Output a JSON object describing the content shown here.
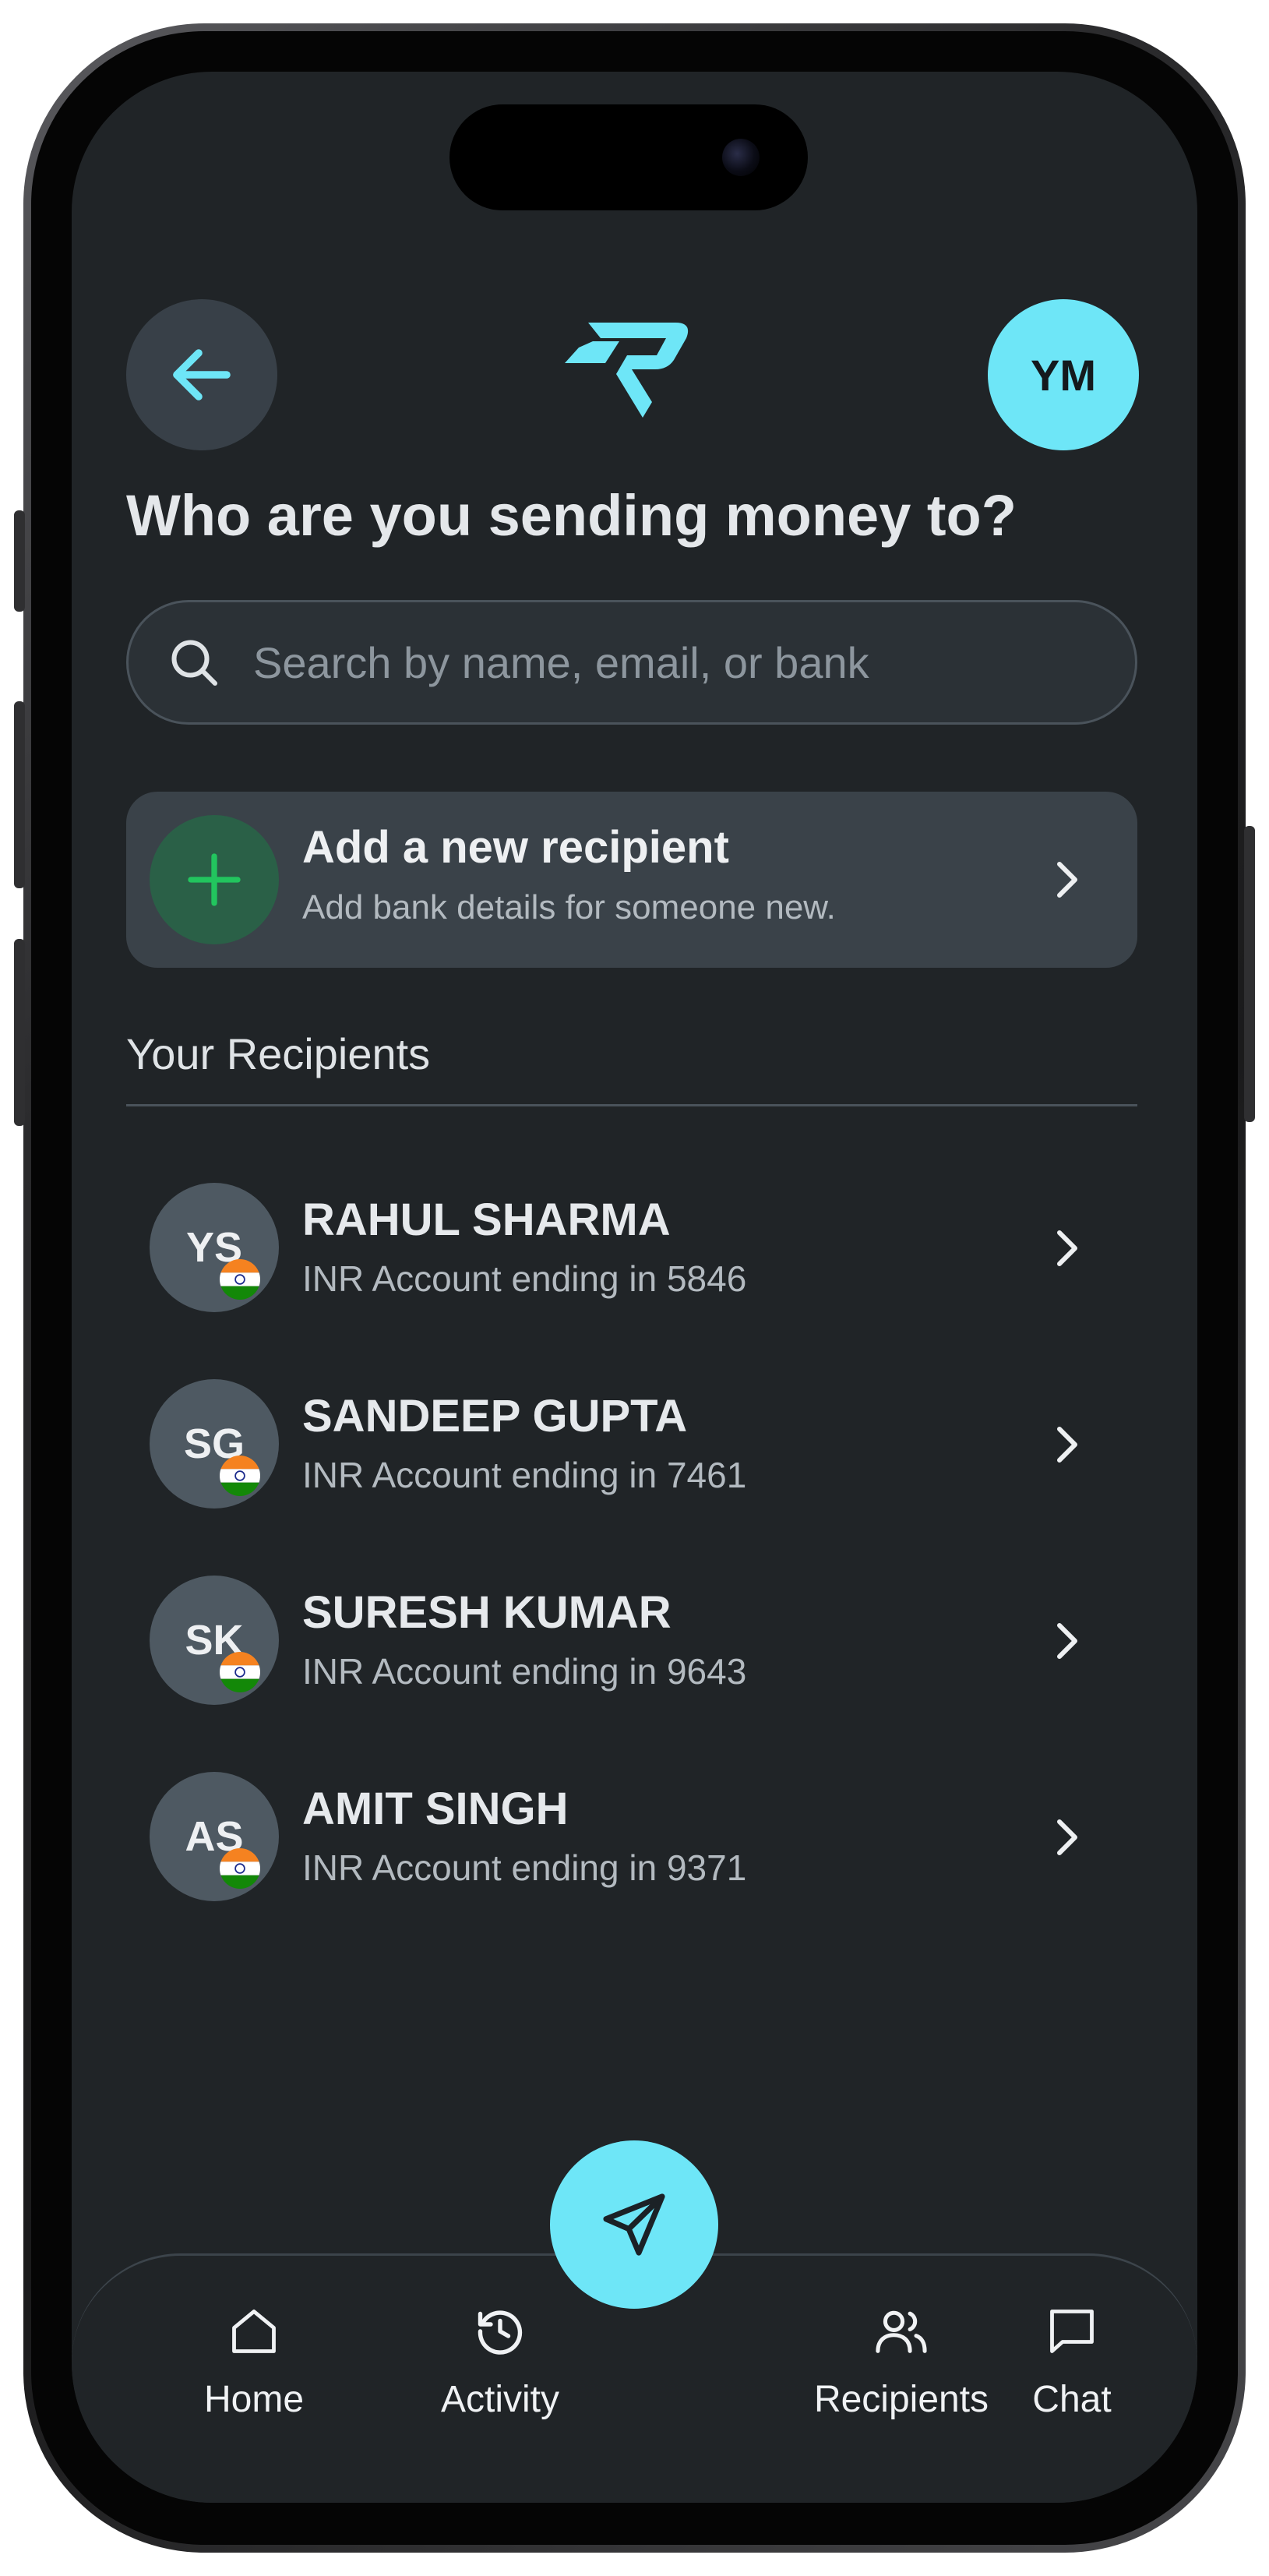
{
  "header": {
    "back_icon": "arrow-left-icon",
    "logo": "brand-logo",
    "user_initials": "YM"
  },
  "title": "Who are you sending money to?",
  "search": {
    "icon": "search-icon",
    "placeholder": "Search by name, email, or bank",
    "value": ""
  },
  "add_recipient": {
    "icon": "plus-icon",
    "title": "Add a new recipient",
    "subtitle": "Add bank details for someone new."
  },
  "recipients_section": {
    "title": "Your Recipients",
    "items": [
      {
        "initials": "YS",
        "name": "RAHUL SHARMA",
        "account": "INR Account ending in 5846",
        "flag": "india-flag-icon"
      },
      {
        "initials": "SG",
        "name": "SANDEEP GUPTA",
        "account": "INR Account ending in 7461",
        "flag": "india-flag-icon"
      },
      {
        "initials": "SK",
        "name": "SURESH KUMAR",
        "account": "INR Account ending in 9643",
        "flag": "india-flag-icon"
      },
      {
        "initials": "AS",
        "name": "AMIT SINGH",
        "account": "INR Account ending in 9371",
        "flag": "india-flag-icon"
      }
    ]
  },
  "bottom_nav": {
    "items": [
      {
        "label": "Home",
        "icon": "home-icon"
      },
      {
        "label": "Activity",
        "icon": "history-icon"
      },
      {
        "label": "Recipients",
        "icon": "users-icon"
      },
      {
        "label": "Chat",
        "icon": "chat-icon"
      }
    ],
    "fab_icon": "send-icon"
  },
  "colors": {
    "background": "#202427",
    "accent": "#6ee6f7",
    "card": "#3a4249",
    "add_green": "#22c55e",
    "text_primary": "#e6e9ec",
    "text_secondary": "#b3bac0"
  }
}
